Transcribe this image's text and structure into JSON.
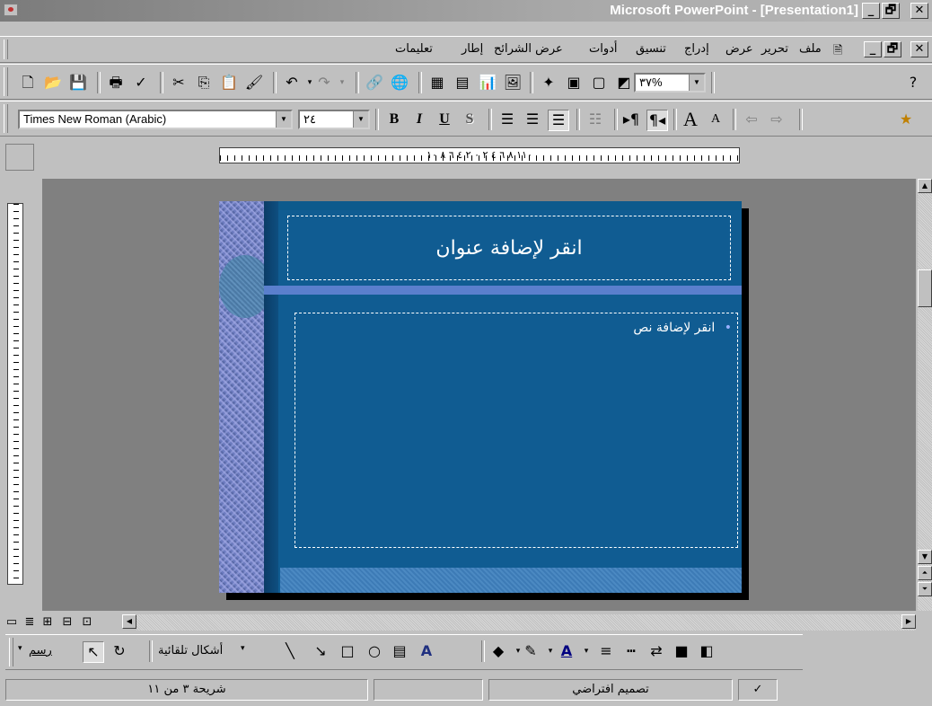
{
  "window": {
    "title": "Microsoft PowerPoint - [Presentation1]",
    "controls": [
      "_",
      "🗗",
      "✕"
    ]
  },
  "menu": {
    "items": [
      "ملف",
      "تحرير",
      "عرض",
      "إدراج",
      "تنسيق",
      "أدوات",
      "عرض الشرائح",
      "إطار",
      "تعليمات"
    ],
    "doc_controls": [
      "✕",
      "🗗",
      "_"
    ]
  },
  "toolbar1": {
    "zoom": "٣٧%"
  },
  "toolbar2": {
    "font": "Times New Roman (Arabic)",
    "size": "٢٤",
    "bold": "B",
    "italic": "I",
    "underline": "U",
    "shadow": "S"
  },
  "ruler": {
    "labels": "١١٠ ٨ ٦ ٤ ٢ ٠ ٢ ٤ ٦ ٨ ١٠"
  },
  "slide": {
    "title_placeholder": "انقر لإضافة عنوان",
    "body_placeholder": "انقر لإضافة نص",
    "bullet": "•"
  },
  "drawing": {
    "draw_label": "رسم",
    "autoshapes_label": "أشكال تلقائية"
  },
  "status": {
    "slide_indicator": "شريحة ٣ من ١١",
    "design": "تصميم افتراضي"
  },
  "colors": {
    "slide_bg": "#105c92",
    "workspace": "#808080",
    "chrome": "#c0c0c0"
  }
}
